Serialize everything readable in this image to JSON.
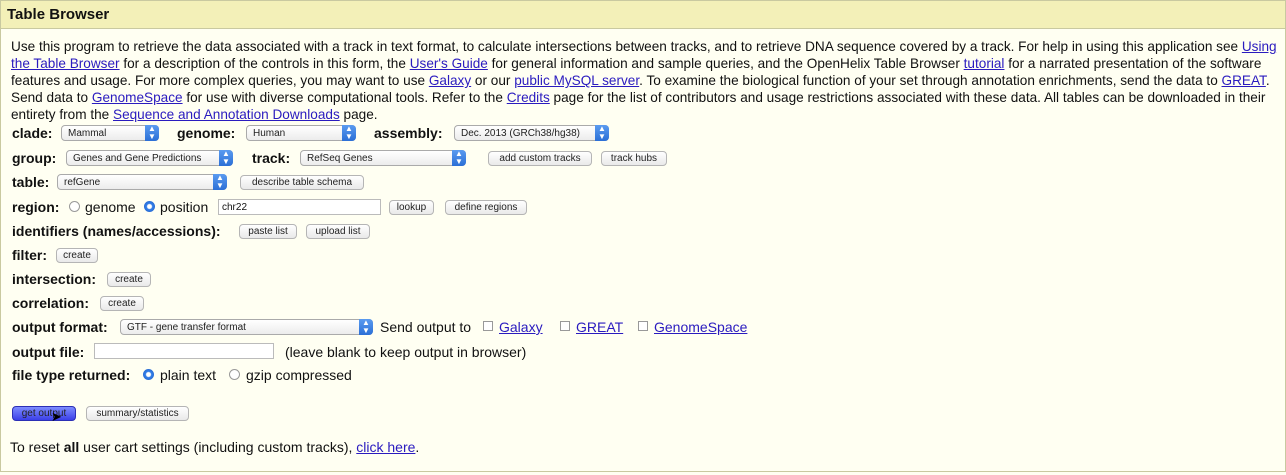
{
  "window": {
    "title": "Table Browser"
  },
  "intro": {
    "t1": "Use this program to retrieve the data associated with a track in text format, to calculate intersections between tracks, and to retrieve DNA sequence covered by a track. For help in using this application see ",
    "link_using": "Using the Table Browser",
    "t2": " for a description of the controls in this form, the ",
    "link_guide": "User's Guide",
    "t3": " for general information and sample queries, and the OpenHelix Table Browser ",
    "link_tutorial": "tutorial",
    "t4": " for a narrated presentation of the software features and usage. For more complex queries, you may want to use ",
    "link_galaxy": "Galaxy",
    "t5": " or our ",
    "link_mysql": "public MySQL server",
    "t6": ". To examine the biological function of your set through annotation enrichments, send the data to ",
    "link_great": "GREAT",
    "t7": ". Send data to ",
    "link_genomespace": "GenomeSpace",
    "t8": " for use with diverse computational tools. Refer to the ",
    "link_credits": "Credits",
    "t9": " page for the list of contributors and usage restrictions associated with these data. All tables can be downloaded in their entirety from the ",
    "link_downloads": "Sequence and Annotation Downloads",
    "t10": " page."
  },
  "form": {
    "clade_label": "clade:",
    "clade_value": "Mammal",
    "genome_label": "genome:",
    "genome_value": "Human",
    "assembly_label": "assembly:",
    "assembly_value": "Dec. 2013 (GRCh38/hg38)",
    "group_label": "group:",
    "group_value": "Genes and Gene Predictions",
    "track_label": "track:",
    "track_value": "RefSeq Genes",
    "add_custom_tracks": "add custom tracks",
    "track_hubs": "track hubs",
    "table_label": "table:",
    "table_value": "refGene",
    "describe_schema": "describe table schema",
    "region_label": "region:",
    "region_genome": "genome",
    "region_position": "position",
    "position_value": "chr22",
    "lookup": "lookup",
    "define_regions": "define regions",
    "identifiers_label": "identifiers (names/accessions):",
    "paste_list": "paste list",
    "upload_list": "upload list",
    "filter_label": "filter:",
    "filter_create": "create",
    "intersection_label": "intersection:",
    "intersection_create": "create",
    "correlation_label": "correlation:",
    "correlation_create": "create",
    "output_format_label": "output format:",
    "output_format_value": "GTF - gene transfer format",
    "send_output_to": "Send output to",
    "send_galaxy": "Galaxy",
    "send_great": "GREAT",
    "send_genomespace": "GenomeSpace",
    "output_file_label": "output file:",
    "output_file_value": "",
    "output_file_hint": "(leave blank to keep output in browser)",
    "file_type_label": "file type returned:",
    "file_plain": "plain text",
    "file_gzip": "gzip compressed",
    "get_output": "get output",
    "summary_statistics": "summary/statistics",
    "reset_t1": "To reset ",
    "reset_all": "all",
    "reset_t2": " user cart settings (including custom tracks), ",
    "reset_link": "click here",
    "reset_t3": "."
  }
}
